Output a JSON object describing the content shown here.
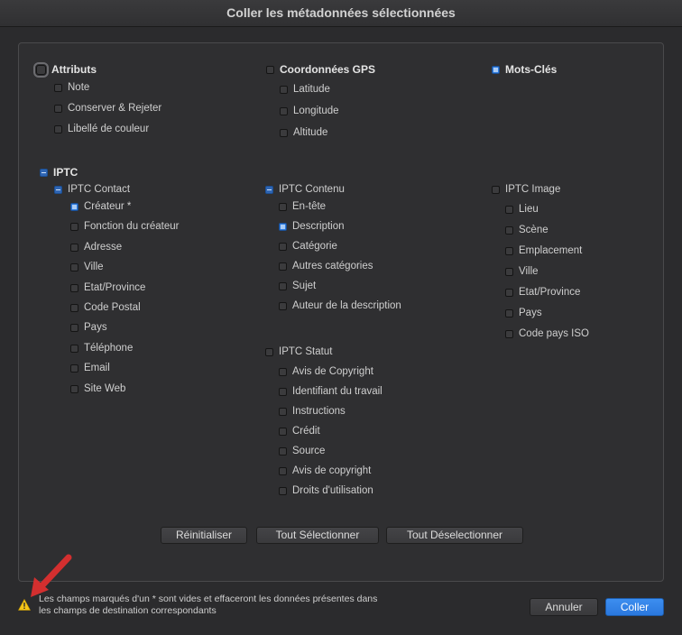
{
  "window": {
    "title": "Coller les métadonnées sélectionnées"
  },
  "attributs": {
    "label": "Attributs",
    "items": [
      "Note",
      "Conserver & Rejeter",
      "Libellé de couleur"
    ]
  },
  "gps": {
    "label": "Coordonnées GPS",
    "items": [
      "Latitude",
      "Longitude",
      "Altitude"
    ]
  },
  "motscles": {
    "label": "Mots-Clés"
  },
  "iptc": {
    "label": "IPTC"
  },
  "iptc_contact": {
    "label": "IPTC Contact",
    "items": [
      "Créateur *",
      "Fonction du créateur",
      "Adresse",
      "Ville",
      "Etat/Province",
      "Code Postal",
      "Pays",
      "Téléphone",
      "Email",
      "Site Web"
    ]
  },
  "iptc_contenu": {
    "label": "IPTC Contenu",
    "items": [
      "En-tête",
      "Description",
      "Catégorie",
      "Autres catégories",
      "Sujet",
      "Auteur de la description"
    ]
  },
  "iptc_statut": {
    "label": "IPTC Statut",
    "items": [
      "Avis de Copyright",
      "Identifiant du travail",
      "Instructions",
      "Crédit",
      "Source",
      "Avis de copyright",
      "Droits d'utilisation"
    ]
  },
  "iptc_image": {
    "label": "IPTC Image",
    "items": [
      "Lieu",
      "Scène",
      "Emplacement",
      "Ville",
      "Etat/Province",
      "Pays",
      "Code pays ISO"
    ]
  },
  "buttons": {
    "reset": "Réinitialiser",
    "select_all": "Tout Sélectionner",
    "deselect_all": "Tout Déselectionner",
    "cancel": "Annuler",
    "paste": "Coller"
  },
  "footer": {
    "warning_line1": "Les champs marqués d'un * sont vides et effaceront les données présentes dans",
    "warning_line2": "les champs de destination correspondants"
  },
  "colors": {
    "accent": "#2f7de0",
    "annotation_arrow": "#d32f2f",
    "warning": "#f5c518"
  }
}
